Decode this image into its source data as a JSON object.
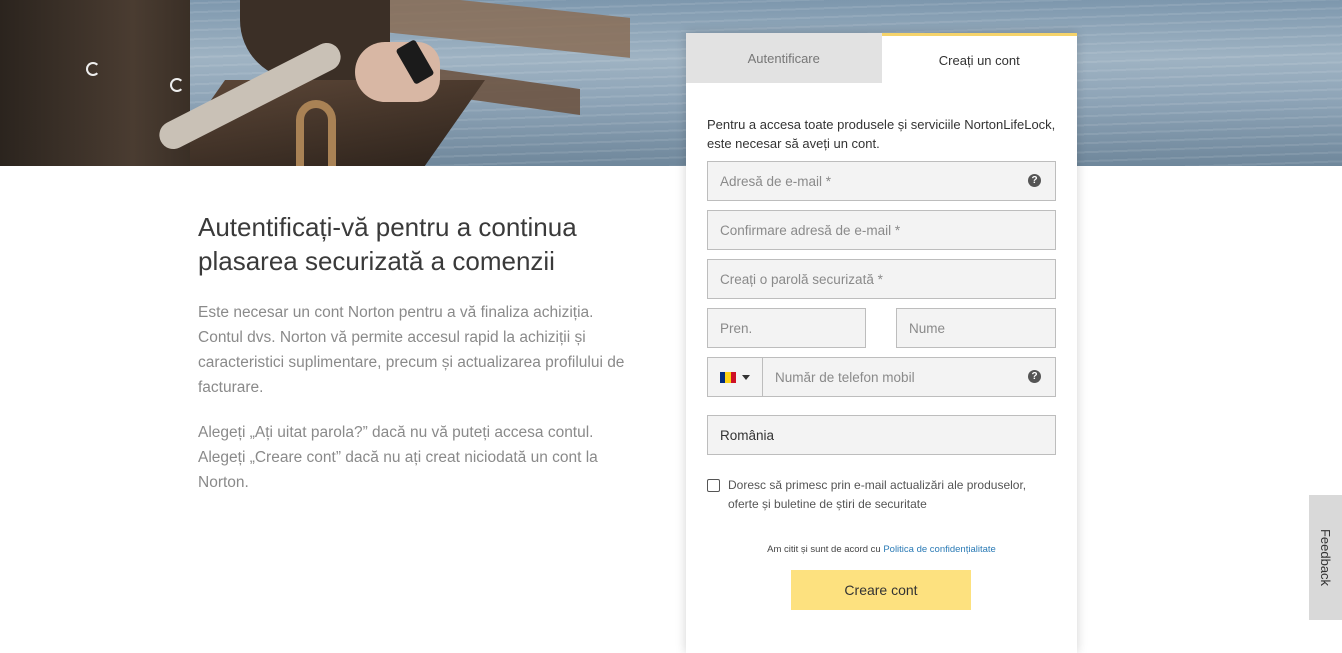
{
  "intro": {
    "heading": "Autentificați-vă pentru a continua plasarea securizată a comenzii",
    "para1": "Este necesar un cont Norton pentru a vă finaliza achiziția. Contul dvs. Norton vă permite accesul rapid la achiziții și caracteristici suplimentare, precum și actualizarea profilului de facturare.",
    "para2": "Alegeți „Ați uitat parola?” dacă nu vă puteți accesa contul. Alegeți „Creare cont” dacă nu ați creat niciodată un cont la Norton."
  },
  "tabs": {
    "login": "Autentificare",
    "create": "Creați un cont"
  },
  "form": {
    "lead": "Pentru a accesa toate produsele și serviciile NortonLifeLock, este necesar să aveți un cont.",
    "email_placeholder": "Adresă de e-mail *",
    "email_confirm_placeholder": "Confirmare adresă de e-mail *",
    "password_placeholder": "Creați o parolă securizată *",
    "firstname_placeholder": "Pren.",
    "lastname_placeholder": "Nume",
    "phone_placeholder": "Număr de telefon mobil",
    "help_glyph": "?",
    "country_value": "România",
    "flag_colors": [
      "#002b7f",
      "#fcd116",
      "#ce1126"
    ],
    "optin_label": "Doresc să primesc prin e-mail actualizări ale produselor, oferte și buletine de știri de securitate",
    "agree_text": "Am citit și sunt de acord cu",
    "privacy_link": "Politica de confidențialitate",
    "submit_label": "Creare cont"
  },
  "feedback": {
    "label": "Feedback"
  },
  "colors": {
    "accent": "#fde17f",
    "tab_active_border": "#f5d36a",
    "link": "#2a7ab5"
  }
}
